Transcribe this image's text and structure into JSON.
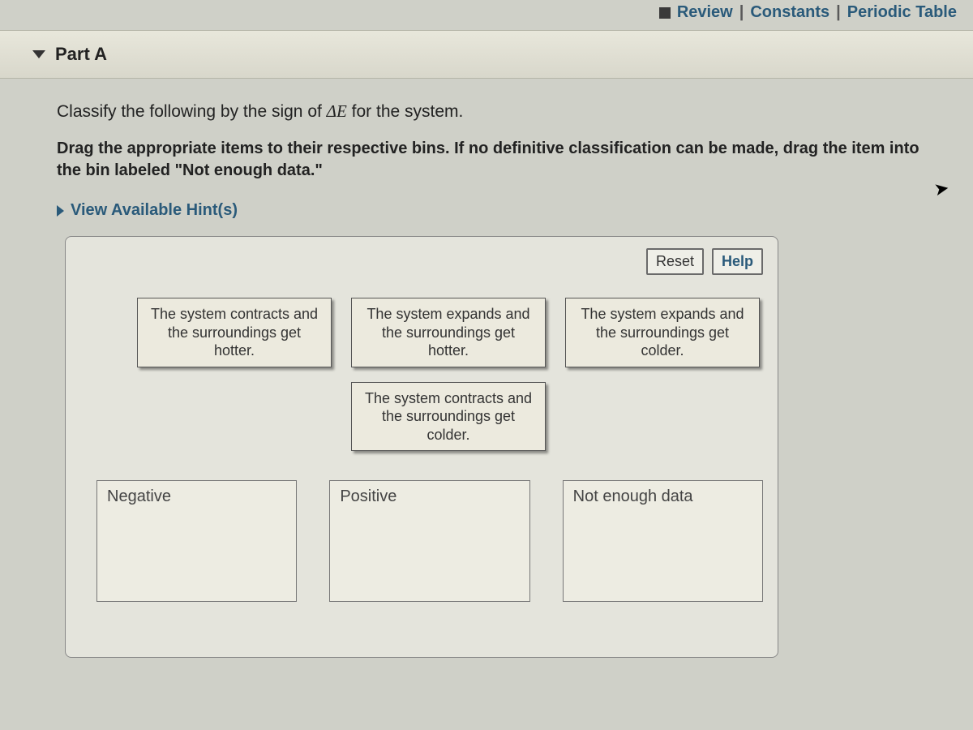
{
  "topLinks": {
    "review": "Review",
    "constants": "Constants",
    "periodic": "Periodic Table"
  },
  "partHeader": {
    "title": "Part A"
  },
  "prompt": {
    "prefix": "Classify the following by the sign of ",
    "delta": "ΔE",
    "suffix": " for the system."
  },
  "instructions": "Drag the appropriate items to their respective bins.  If no definitive classification can be made, drag the item into the bin labeled \"Not enough data.\"",
  "hints": {
    "label": "View Available Hint(s)"
  },
  "toolbar": {
    "reset": "Reset",
    "help": "Help"
  },
  "tiles": {
    "t1": "The system contracts and the surroundings get hotter.",
    "t2": "The system expands and the surroundings get hotter.",
    "t3": "The system expands and the surroundings get colder.",
    "t4": "The system contracts and the surroundings get colder."
  },
  "bins": {
    "negative": "Negative",
    "positive": "Positive",
    "notenough": "Not enough data"
  }
}
